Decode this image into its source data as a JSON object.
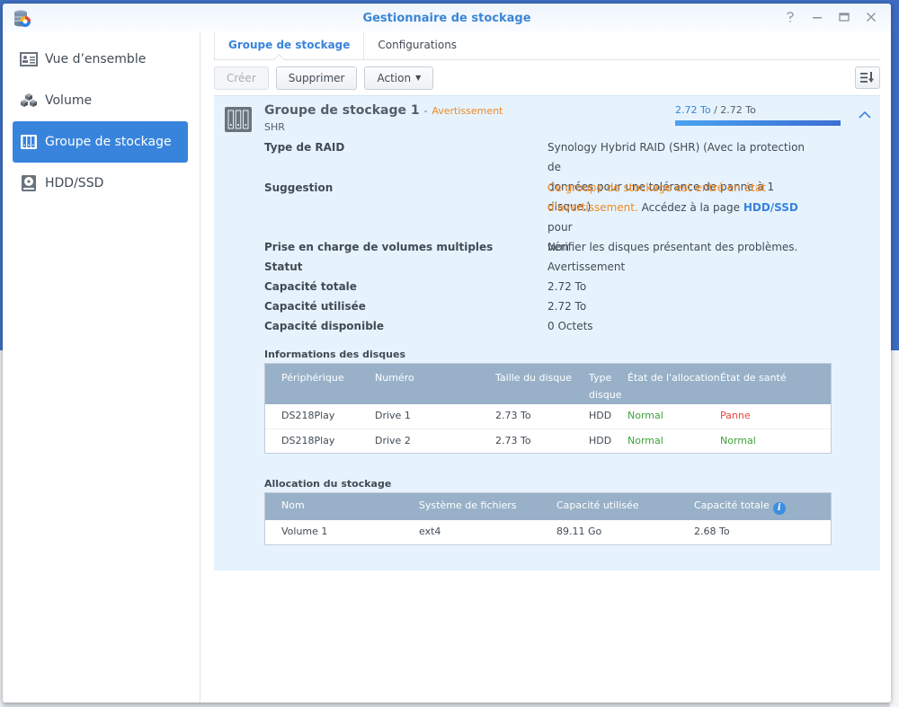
{
  "window": {
    "title": "Gestionnaire de stockage",
    "controls": [
      "help",
      "minimize",
      "maximize",
      "close"
    ]
  },
  "sidebar": {
    "items": [
      {
        "label": "Vue d’ensemble",
        "icon": "overview-icon",
        "active": false
      },
      {
        "label": "Volume",
        "icon": "volume-cubes-icon",
        "active": false
      },
      {
        "label": "Groupe de stockage",
        "icon": "storage-pool-icon",
        "active": true
      },
      {
        "label": "HDD/SSD",
        "icon": "hdd-icon",
        "active": false
      }
    ]
  },
  "tabs": [
    {
      "label": "Groupe de stockage",
      "active": true
    },
    {
      "label": "Configurations",
      "active": false
    }
  ],
  "toolbar": {
    "create_label": "Créer",
    "delete_label": "Supprimer",
    "action_label": "Action",
    "sort_icon": "sort-icon"
  },
  "pool": {
    "name": "Groupe de stockage 1",
    "separator": "-",
    "status_label": "Avertissement",
    "type": "SHR",
    "usage": {
      "used": "2.72 To",
      "separator": "/",
      "total": "2.72 To",
      "fraction": 1.0
    },
    "colors": {
      "warning": "#f08a24",
      "accent": "#3884dc",
      "ok": "#3ea13a",
      "error": "#e8453c"
    },
    "details": [
      {
        "key": "Type de RAID",
        "value_lines": [
          "Synology Hybrid RAID (SHR) (Avec la protection de",
          "données pour une tolérance de panne à 1 disque.)"
        ]
      },
      {
        "key": "Suggestion",
        "warn_line1": "Ce groupe de stockage est entré en état",
        "warn_line2": "d'avertissement.",
        "text_a": "Accédez à la page",
        "link": "HDD/SSD",
        "text_b": "pour",
        "line3": "vérifier les disques présentant des problèmes."
      },
      {
        "key": "Prise en charge de volumes multiples",
        "value": "Non"
      },
      {
        "key": "Statut",
        "value": "Avertissement"
      },
      {
        "key": "Capacité totale",
        "value": "2.72 To"
      },
      {
        "key": "Capacité utilisée",
        "value": "2.72 To"
      },
      {
        "key": "Capacité disponible",
        "value": "0 Octets"
      }
    ],
    "disks": {
      "title": "Informations des disques",
      "headers": [
        "Périphérique",
        "Numéro",
        "Taille du disque",
        "Type disque",
        "État de l'allocation",
        "État de santé"
      ],
      "rows": [
        [
          "DS218Play",
          "Drive 1",
          "2.73 To",
          "HDD",
          "Normal",
          "Panne"
        ],
        [
          "DS218Play",
          "Drive 2",
          "2.73 To",
          "HDD",
          "Normal",
          "Normal"
        ]
      ]
    },
    "allocation": {
      "title": "Allocation du stockage",
      "headers": [
        "Nom",
        "Système de fichiers",
        "Capacité utilisée",
        "Capacité totale"
      ],
      "rows": [
        [
          "Volume 1",
          "ext4",
          "89.11 Go",
          "2.68 To"
        ]
      ]
    }
  }
}
